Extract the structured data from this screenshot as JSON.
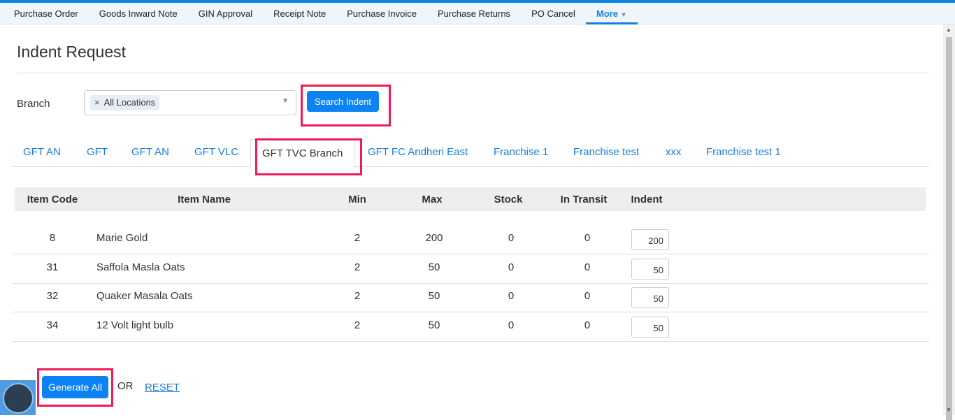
{
  "nav": [
    "Purchase Order",
    "Goods Inward Note",
    "GIN Approval",
    "Receipt Note",
    "Purchase Invoice",
    "Purchase Returns",
    "PO Cancel",
    "More"
  ],
  "page_title": "Indent Request",
  "branch": {
    "label": "Branch",
    "chip": "All Locations",
    "remove": "×"
  },
  "search_button": "Search Indent",
  "tabs": [
    "GFT AN",
    "GFT",
    "GFT AN",
    "GFT VLC",
    "GFT TVC Branch",
    "GFT FC Andheri East",
    "Franchise 1",
    "Franchise test",
    "xxx",
    "Franchise test 1"
  ],
  "table": {
    "headers": [
      "Item Code",
      "Item Name",
      "Min",
      "Max",
      "Stock",
      "In Transit",
      "Indent"
    ],
    "rows": [
      [
        "8",
        "Marie Gold",
        "2",
        "200",
        "0",
        "0",
        "200"
      ],
      [
        "31",
        "Saffola Masla Oats",
        "2",
        "50",
        "0",
        "0",
        "50"
      ],
      [
        "32",
        "Quaker Masala Oats",
        "2",
        "50",
        "0",
        "0",
        "50"
      ],
      [
        "34",
        "12 Volt light bulb",
        "2",
        "50",
        "0",
        "0",
        "50"
      ]
    ]
  },
  "generate_button": "Generate All",
  "or_text": "OR",
  "reset_link": "RESET"
}
